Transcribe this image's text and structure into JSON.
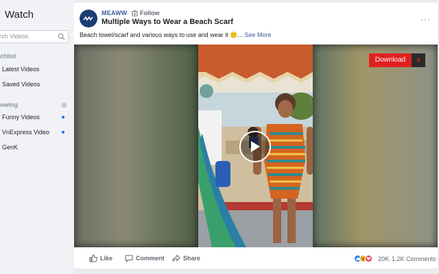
{
  "sidebar": {
    "title": "Watch",
    "search_placeholder": "rch Videos",
    "sections": [
      {
        "label": "chlist",
        "items": [
          {
            "label": "Latest Videos"
          },
          {
            "label": "Saved Videos"
          }
        ]
      },
      {
        "label": "owing",
        "items": [
          {
            "label": "Funny Videos"
          },
          {
            "label": "VnExpress Video"
          },
          {
            "label": "GenK"
          }
        ]
      }
    ]
  },
  "post": {
    "page_name": "MEAWW",
    "separator": "·",
    "follow_label": "Follow",
    "title": "Multiple Ways to Wear a Beach Scarf",
    "caption": "Beach towel/scarf and various ways to use and wear it 🙂...",
    "see_more": "See More"
  },
  "video": {
    "download_label": "Download",
    "close_label": "x"
  },
  "actions": {
    "like": "Like",
    "comment": "Comment",
    "share": "Share"
  },
  "stats": {
    "reactions_count": "20K",
    "separator": "·",
    "comments_count": "1.2K Comments"
  },
  "colors": {
    "link": "#385898",
    "brand_blue": "#1877f2",
    "download_red": "#e02020",
    "avatar_bg": "#1b3c74"
  }
}
